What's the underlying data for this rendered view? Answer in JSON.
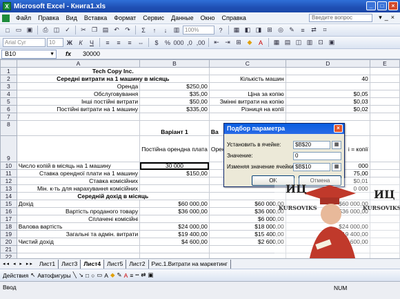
{
  "window": {
    "title": "Microsoft Excel - Книга1.xls"
  },
  "menu": [
    "Файл",
    "Правка",
    "Вид",
    "Вставка",
    "Формат",
    "Сервис",
    "Данные",
    "Окно",
    "Справка"
  ],
  "question_placeholder": "Введите вопрос",
  "toolbar": {
    "zoom": "100%",
    "font": "Arial Cyr",
    "size": "10"
  },
  "formula_bar": {
    "name_box": "B10",
    "fx": "fx",
    "value": "30000"
  },
  "columns": [
    "A",
    "B",
    "C",
    "D",
    "E"
  ],
  "rows": [
    {
      "n": "1",
      "cells": [
        "Tech Copy Inc.",
        "",
        "",
        "",
        ""
      ]
    },
    {
      "n": "2",
      "cells": [
        "Середні витрати на 1 машину в місяць",
        "",
        "Кількість машин",
        "40",
        ""
      ]
    },
    {
      "n": "3",
      "cells": [
        "Оренда",
        "$250,00",
        "",
        "",
        ""
      ]
    },
    {
      "n": "4",
      "cells": [
        "Обслуговування",
        "$35,00",
        "Ціна за копію",
        "$0,05",
        ""
      ]
    },
    {
      "n": "5",
      "cells": [
        "Інші постійні витрати",
        "$50,00",
        "Змінні витрати на копію",
        "$0,03",
        ""
      ]
    },
    {
      "n": "6",
      "cells": [
        "Постійні витрати на 1 машину",
        "$335,00",
        "Різниця на копії",
        "$0,02",
        ""
      ]
    },
    {
      "n": "7",
      "cells": [
        "",
        "",
        "",
        "",
        ""
      ]
    },
    {
      "n": "8",
      "cells": [
        "",
        "Варіант 1",
        "Ва",
        "",
        ""
      ]
    },
    {
      "n": "9",
      "cells": [
        "",
        "Постійна орендна плата",
        "Орендна пл",
        "і = копії",
        ""
      ]
    },
    {
      "n": "10",
      "cells": [
        "Число копій в місяць на 1 машину",
        "30 000",
        "",
        "000",
        ""
      ]
    },
    {
      "n": "11",
      "cells": [
        "Ставка орендної плати на 1 машину",
        "$150,00",
        "",
        "75,00",
        ""
      ]
    },
    {
      "n": "12",
      "cells": [
        "Ставка комісійних",
        "",
        "",
        "$0,01",
        ""
      ]
    },
    {
      "n": "13",
      "cells": [
        "Мін. к-ть для нарахування комісійних",
        "",
        "",
        "0 000",
        ""
      ]
    },
    {
      "n": "14",
      "cells": [
        "Середній дохід в місяць",
        "",
        "",
        "",
        ""
      ]
    },
    {
      "n": "15",
      "cells": [
        "Дохід",
        "$60 000,00",
        "$60 000,00",
        "$60 000,00",
        ""
      ]
    },
    {
      "n": "16",
      "cells": [
        "Вартість проданого товару",
        "$36 000,00",
        "$36 000,00",
        "$36 000,00",
        ""
      ]
    },
    {
      "n": "17",
      "cells": [
        "Сплачені комісійні",
        "",
        "$6 000,00",
        "",
        ""
      ]
    },
    {
      "n": "18",
      "cells": [
        "Валова вартість",
        "$24 000,00",
        "$18 000,00",
        "$24 000,00",
        ""
      ]
    },
    {
      "n": "19",
      "cells": [
        "Загальні та адмін. витрати",
        "$19 400,00",
        "$15 400,00",
        "$19 400,00",
        ""
      ]
    },
    {
      "n": "20",
      "cells": [
        "Чистий дохід",
        "$4 600,00",
        "$2 600,00",
        "$4 600,00",
        ""
      ]
    },
    {
      "n": "21",
      "cells": [
        "",
        "",
        "",
        "",
        ""
      ]
    },
    {
      "n": "22",
      "cells": [
        "",
        "",
        "",
        "",
        ""
      ]
    },
    {
      "n": "23",
      "cells": [
        "",
        "",
        "",
        "",
        ""
      ]
    }
  ],
  "dialog": {
    "title": "Подбор параметра",
    "set_cell_label": "Установить в ячейке:",
    "set_cell_value": "$B$20",
    "value_label": "Значение:",
    "value_value": "0",
    "change_cell_label": "Изменяя значение ячейки:",
    "change_cell_value": "$B$10",
    "ok": "OK",
    "cancel": "Отмена"
  },
  "sheet_tabs": [
    "Лист1",
    "Лист3",
    "Лист4",
    "Лист5",
    "Лист2",
    "Рис.1.Витрати на маркетинг"
  ],
  "active_tab": "Лист4",
  "drawing_toolbar": {
    "actions": "Действия",
    "autoshapes": "Автофигуры"
  },
  "status": {
    "mode": "Ввод",
    "num": "NUM"
  },
  "watermark": {
    "left_big": "ИЦ",
    "left_small": "KURSOVIKS",
    "right_big": "ИЦ",
    "right_small": "KURSOVIKS"
  }
}
